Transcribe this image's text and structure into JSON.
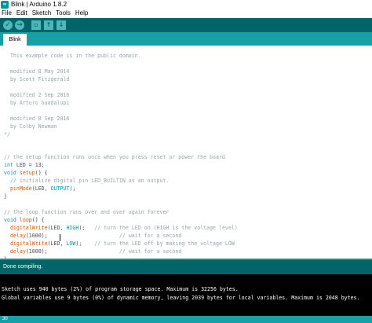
{
  "window": {
    "app_icon_text": "∞",
    "title": "Blink | Arduino 1.8.2"
  },
  "menubar": {
    "items": [
      "File",
      "Edit",
      "Sketch",
      "Tools",
      "Help"
    ]
  },
  "toolbar": {
    "buttons": [
      {
        "name": "verify",
        "glyph": "✓"
      },
      {
        "name": "upload",
        "glyph": "→"
      },
      {
        "name": "new",
        "glyph": "▫"
      },
      {
        "name": "open",
        "glyph": "↑"
      },
      {
        "name": "save",
        "glyph": "↓"
      }
    ]
  },
  "tabs": [
    {
      "label": "Blink",
      "active": true
    }
  ],
  "editor": {
    "lines": [
      {
        "text": "  This example code is in the public domain.",
        "kind": "comment"
      },
      {
        "text": "",
        "kind": "plain"
      },
      {
        "text": "  modified 8 May 2014",
        "kind": "comment"
      },
      {
        "text": "  by Scott Fitzgerald",
        "kind": "comment"
      },
      {
        "text": "",
        "kind": "plain"
      },
      {
        "text": "  modified 2 Sep 2016",
        "kind": "comment"
      },
      {
        "text": "  by Arturo Guadalupi",
        "kind": "comment"
      },
      {
        "text": "",
        "kind": "plain"
      },
      {
        "text": "  modified 8 Sep 2016",
        "kind": "comment"
      },
      {
        "text": "  by Colby Newman",
        "kind": "comment"
      },
      {
        "text": "*/",
        "kind": "comment"
      },
      {
        "text": "",
        "kind": "plain"
      },
      {
        "text": "",
        "kind": "plain"
      },
      {
        "text": "// the setup function runs once when you press reset or power the board",
        "kind": "comment"
      },
      {
        "text": "int LED = 13;",
        "kind": "mixed"
      },
      {
        "text": "void setup() {",
        "kind": "mixed"
      },
      {
        "text": "  // initialize digital pin LED_BUILTIN as an output.",
        "kind": "comment"
      },
      {
        "text": "  pinMode(LED, OUTPUT);",
        "kind": "mixed"
      },
      {
        "text": "}",
        "kind": "plain"
      },
      {
        "text": "",
        "kind": "plain"
      },
      {
        "text": "// the loop function runs over and over again forever",
        "kind": "comment"
      },
      {
        "text": "void loop() {",
        "kind": "mixed"
      },
      {
        "text": "  digitalWrite(LED, HIGH);   // turn the LED on (HIGH is the voltage level)",
        "kind": "mixed"
      },
      {
        "text": "  delay(1000);                       // wait for a second",
        "kind": "mixed"
      },
      {
        "text": "  digitalWrite(LED, LOW);    // turn the LED off by making the voltage LOW",
        "kind": "mixed"
      },
      {
        "text": "  delay(1000);                       // wait for a second",
        "kind": "mixed"
      },
      {
        "text": "}",
        "kind": "plain"
      }
    ]
  },
  "status": {
    "message": "Done compiling."
  },
  "console": {
    "lines": [
      "Sketch uses 940 bytes (2%) of program storage space. Maximum is 32256 bytes.",
      "Global variables use 9 bytes (0%) of dynamic memory, leaving 2039 bytes for local variables. Maximum is 2048 bytes."
    ]
  },
  "footer": {
    "line_number": "30"
  },
  "colors": {
    "toolbar_bg": "#006468",
    "tab_bar_bg": "#17a1a5",
    "button_fill": "#4db7bb",
    "comment": "#95a5a6",
    "function": "#d35400",
    "keyword": "#00979c",
    "console_bg": "#000000"
  }
}
